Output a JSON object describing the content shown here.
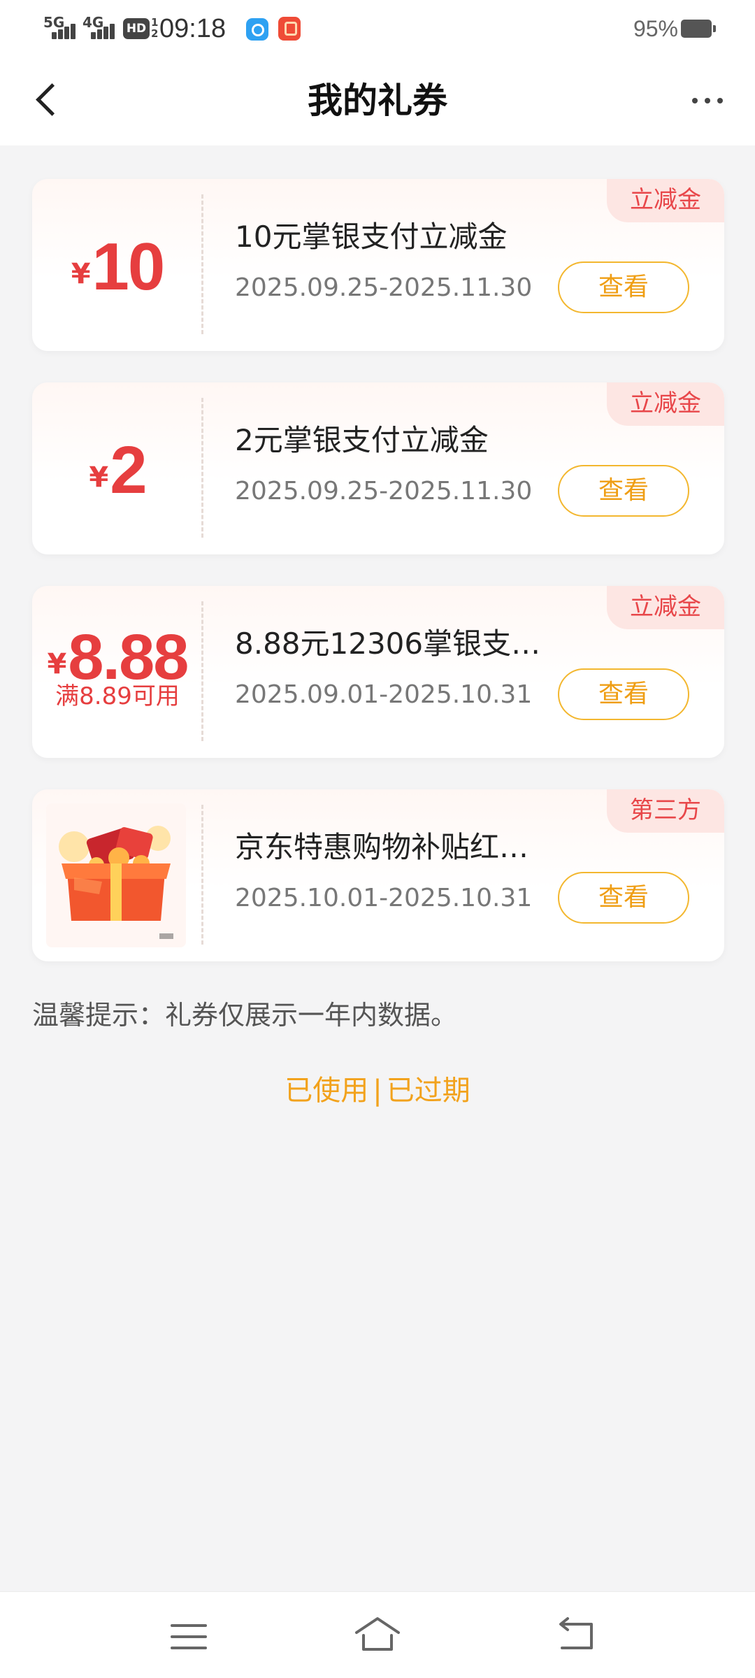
{
  "status_bar": {
    "signal1": "5G",
    "signal2": "4G",
    "hd": "HD",
    "hd_sub1": "1",
    "hd_sub2": "2",
    "time": "09:18",
    "battery": "95%"
  },
  "header": {
    "title": "我的礼券"
  },
  "coupons": [
    {
      "currency": "¥",
      "amount": "10",
      "name": "10元掌银支付立减金",
      "valid": "2025.09.25-2025.11.30",
      "button": "查看",
      "tag": "立减金"
    },
    {
      "currency": "¥",
      "amount": "2",
      "name": "2元掌银支付立减金",
      "valid": "2025.09.25-2025.11.30",
      "button": "查看",
      "tag": "立减金"
    },
    {
      "currency": "¥",
      "amount": "8.88",
      "condition": "满8.89可用",
      "name": "8.88元12306掌银支…",
      "valid": "2025.09.01-2025.10.31",
      "button": "查看",
      "tag": "立减金"
    },
    {
      "image": "gift-box",
      "image_label": "[广告]",
      "name": "京东特惠购物补贴红…",
      "valid": "2025.10.01-2025.10.31",
      "button": "查看",
      "tag": "第三方"
    }
  ],
  "tip": "温馨提示：礼券仅展示一年内数据。",
  "links": {
    "used": "已使用",
    "separator": "|",
    "expired": "已过期"
  },
  "colors": {
    "accent_red": "#e63e3f",
    "accent_orange": "#f2a21c",
    "background": "#f4f4f5"
  }
}
